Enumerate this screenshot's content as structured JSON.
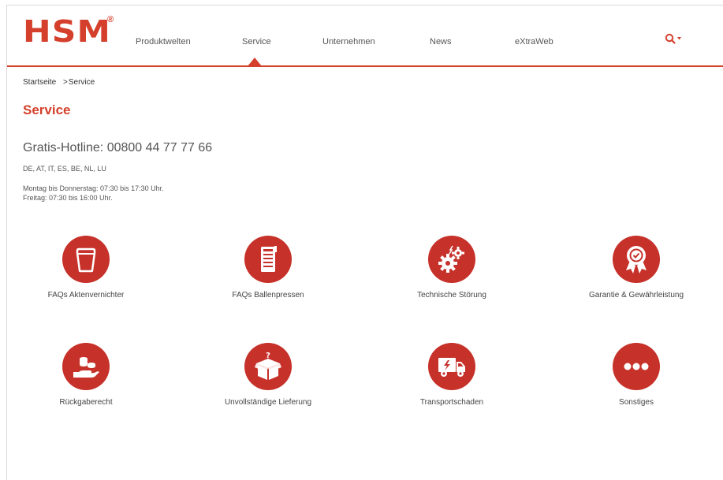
{
  "header": {
    "logo_text": "HSM",
    "logo_reg": "®",
    "nav": [
      {
        "label": "Produktwelten"
      },
      {
        "label": "Service"
      },
      {
        "label": "Unternehmen"
      },
      {
        "label": "News"
      },
      {
        "label": "eXtraWeb"
      }
    ],
    "active_nav": "Service",
    "search_icon": "search-icon",
    "dropdown_glyph": "▾"
  },
  "breadcrumb": {
    "home": "Startseite",
    "separator": ">",
    "current": "Service"
  },
  "page": {
    "title": "Service",
    "hotline": "Gratis-Hotline: 00800 44 77 77 66",
    "countries": "DE, AT, IT, ES, BE, NL, LU",
    "hours_line1": "Montag bis Donnerstag: 07:30 bis 17:30 Uhr.",
    "hours_line2": "Freitag: 07:30 bis 16:00 Uhr."
  },
  "tiles": [
    {
      "label": "FAQs Aktenvernichter",
      "icon": "shredder-icon"
    },
    {
      "label": "FAQs Ballenpressen",
      "icon": "baler-icon"
    },
    {
      "label": "Technische Störung",
      "icon": "gears-icon"
    },
    {
      "label": "Garantie & Gewährleistung",
      "icon": "award-icon"
    },
    {
      "label": "Rückgaberecht",
      "icon": "hand-coins-icon"
    },
    {
      "label": "Unvollständige Lieferung",
      "icon": "box-question-icon"
    },
    {
      "label": "Transportschaden",
      "icon": "truck-damage-icon"
    },
    {
      "label": "Sonstiges",
      "icon": "more-icon"
    }
  ],
  "colors": {
    "brand": "#d4402b",
    "icon_circle": "#c6312a"
  }
}
